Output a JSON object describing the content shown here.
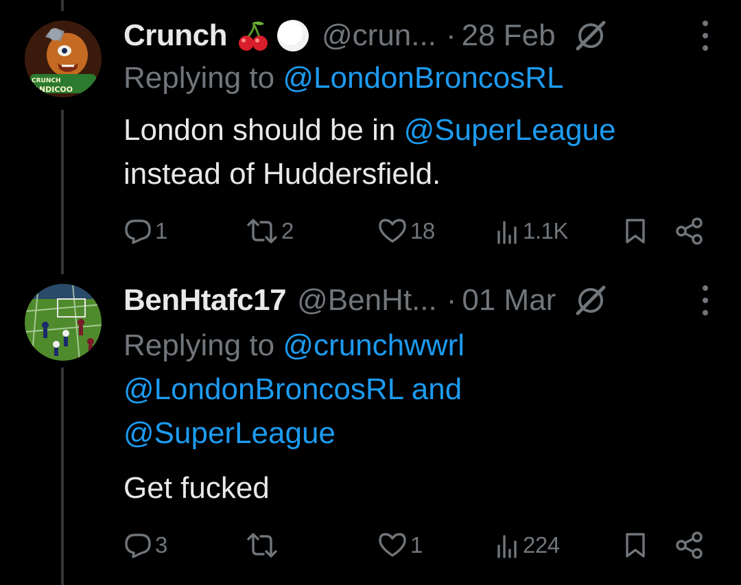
{
  "tweets": [
    {
      "name": "Crunch",
      "emoji": "🍒⚪",
      "handle": "@crun...",
      "separator": "·",
      "date": "28 Feb",
      "replying_prefix": "Replying to",
      "replying_to": [
        "@LondonBroncosRL"
      ],
      "replying_and": "",
      "body_pre": "London should be in ",
      "body_mention": "@SuperLeague",
      "body_post": "instead of Huddersfield.",
      "stats": {
        "replies": "1",
        "retweets": "2",
        "likes": "18",
        "views": "1.1K"
      },
      "avatar_text": [
        "CRUNCH",
        "BANDICOO"
      ]
    },
    {
      "name": "BenHtafc17",
      "handle": "@BenHt...",
      "separator": "·",
      "date": "01 Mar",
      "replying_prefix": "Replying to",
      "replying_to": [
        "@crunchwwrl",
        "@LondonBroncosRL",
        "@SuperLeague"
      ],
      "replying_and": "and",
      "body": "Get fucked",
      "stats": {
        "replies": "3",
        "retweets": "",
        "likes": "1",
        "views": "224"
      }
    }
  ],
  "colors": {
    "background": "#000000",
    "text": "#e7e9ea",
    "secondary": "#71767b",
    "link": "#1d9bf0",
    "thread_line": "#333639"
  },
  "icons": [
    "reply-icon",
    "retweet-icon",
    "like-icon",
    "views-icon",
    "bookmark-icon",
    "share-icon",
    "grok-icon",
    "more-icon"
  ]
}
